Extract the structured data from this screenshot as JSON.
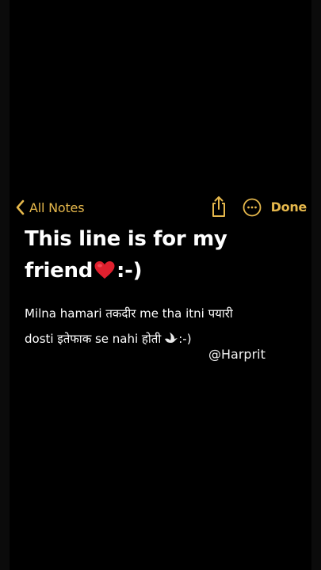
{
  "navbar": {
    "back_label": "All Notes",
    "back_icon": "chevron-left-icon",
    "share_icon": "share-icon",
    "more_icon": "ellipsis-circle-icon",
    "done_label": "Done",
    "accent_color": "#e6b84c"
  },
  "note": {
    "title_line1": "This line is for my",
    "title_line2_before": "friend",
    "title_emoji": "heart-icon",
    "title_line2_after": ":-)",
    "body_line1": "Milna hamari तकदीर me tha itni पयारी",
    "body_line2": "dosti इतेफाक se nahi होती",
    "body_emoji": "dove-icon",
    "body_line2_after": ":-)",
    "signature": "@Harprit"
  },
  "colors": {
    "background": "#000000",
    "text": "#ffffff",
    "heart": "#e0202e"
  }
}
